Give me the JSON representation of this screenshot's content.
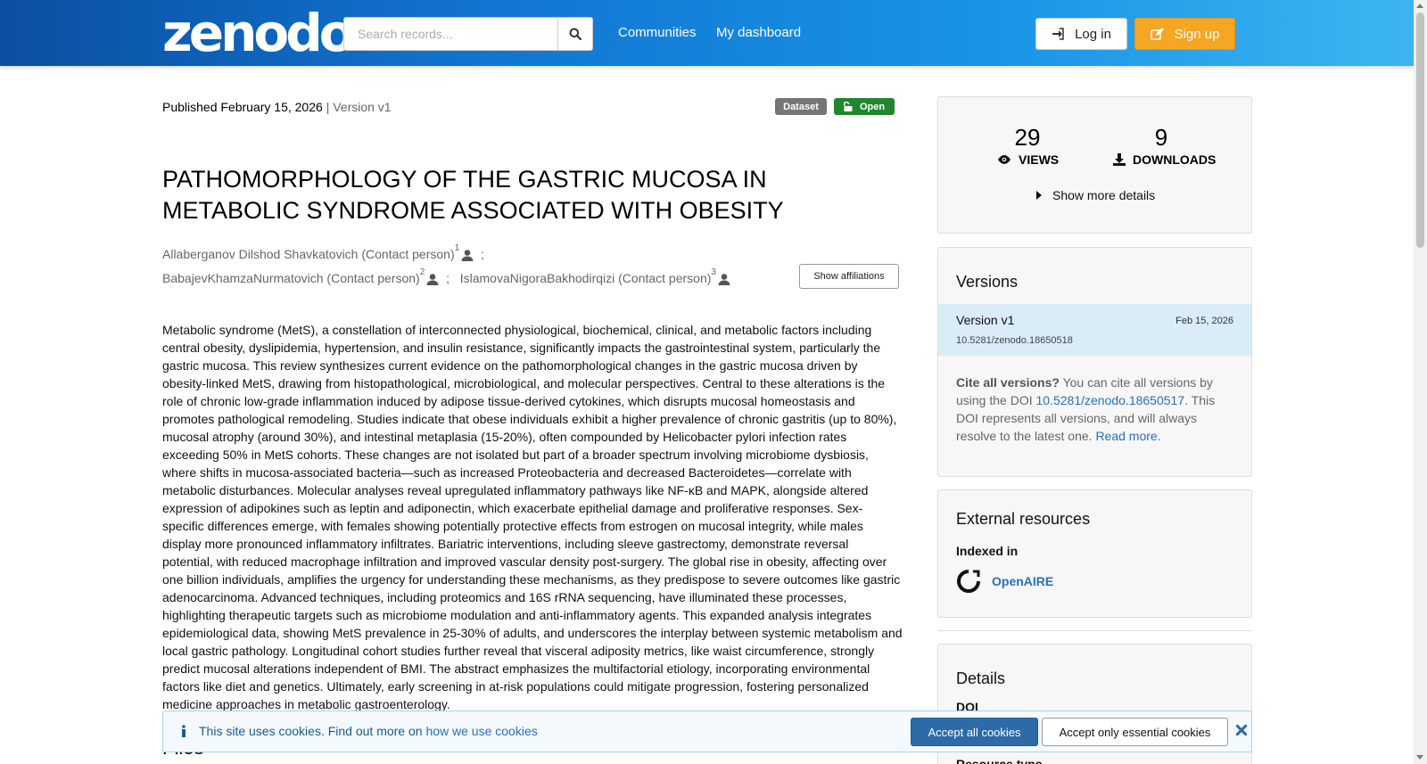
{
  "header": {
    "logo_text": "zenodo",
    "search_placeholder": "Search records...",
    "nav": [
      "Communities",
      "My dashboard"
    ],
    "login_label": "Log in",
    "signup_label": "Sign up"
  },
  "record": {
    "published_label": "Published February 15, 2026",
    "version_label": "| Version v1",
    "badge_type": "Dataset",
    "badge_access": "Open",
    "title": "PATHOMORPHOLOGY OF THE GASTRIC MUCOSA IN METABOLIC SYNDROME ASSOCIATED WITH OBESITY",
    "creators": [
      {
        "name": "Allaberganov Dilshod Shavkatovich (Contact person)",
        "sup": "1"
      },
      {
        "name": "BabajevKhamzaNurmatovich (Contact person)",
        "sup": "2"
      },
      {
        "name": "IslamovaNigoraBakhodirqizi (Contact person)",
        "sup": "3"
      }
    ],
    "show_affiliations_label": "Show affiliations",
    "abstract": "Metabolic syndrome (MetS), a constellation of interconnected physiological, biochemical, clinical, and metabolic factors including central obesity, dyslipidemia, hypertension, and insulin resistance, significantly impacts the gastrointestinal system, particularly the gastric mucosa. This review synthesizes current evidence on the pathomorphological changes in the gastric mucosa driven by obesity-linked MetS, drawing from histopathological, microbiological, and molecular perspectives. Central to these alterations is the role of chronic low-grade inflammation induced by adipose tissue-derived cytokines, which disrupts mucosal homeostasis and promotes pathological remodeling. Studies indicate that obese individuals exhibit a higher prevalence of chronic gastritis (up to 80%), mucosal atrophy (around 30%), and intestinal metaplasia (15-20%), often compounded by Helicobacter pylori infection rates exceeding 50% in MetS cohorts. These changes are not isolated but part of a broader spectrum involving microbiome dysbiosis, where shifts in mucosa-associated bacteria—such as increased Proteobacteria and decreased Bacteroidetes—correlate with metabolic disturbances. Molecular analyses reveal upregulated inflammatory pathways like NF-κB and MAPK, alongside altered expression of adipokines such as leptin and adiponectin, which exacerbate epithelial damage and proliferative responses. Sex-specific differences emerge, with females showing potentially protective effects from estrogen on mucosal integrity, while males display more pronounced inflammatory infiltrates. Bariatric interventions, including sleeve gastrectomy, demonstrate reversal potential, with reduced macrophage infiltration and improved vascular density post-surgery. The global rise in obesity, affecting over one billion individuals, amplifies the urgency for understanding these mechanisms, as they predispose to severe outcomes like gastric adenocarcinoma. Advanced techniques, including proteomics and 16S rRNA sequencing, have illuminated these processes, highlighting therapeutic targets such as microbiome modulation and anti-inflammatory agents. This expanded analysis integrates epidemiological data, showing MetS prevalence in 25-30% of adults, and underscores the interplay between systemic metabolism and local gastric pathology. Longitudinal cohort studies further reveal that visceral adiposity metrics, like waist circumference, strongly predict mucosal alterations independent of BMI. The abstract emphasizes the multifactorial etiology, incorporating environmental factors like diet and genetics. Ultimately, early screening in at-risk populations could mitigate progression, fostering personalized medicine approaches in metabolic gastroenterology.",
    "files_heading": "Files"
  },
  "stats": {
    "views": "29",
    "views_label": "VIEWS",
    "downloads": "9",
    "downloads_label": "DOWNLOADS",
    "more_details_label": "Show more details"
  },
  "versions": {
    "heading": "Versions",
    "current": {
      "name": "Version v1",
      "date": "Feb 15, 2026",
      "doi": "10.5281/zenodo.18650518"
    },
    "cite_bold": "Cite all versions?",
    "cite_text1": " You can cite all versions by using the DOI ",
    "cite_doi": "10.5281/zenodo.18650517",
    "cite_text2": ". This DOI represents all versions, and will always resolve to the latest one. ",
    "read_more": "Read more."
  },
  "external": {
    "heading": "External resources",
    "indexed_in": "Indexed in",
    "resource": "OpenAIRE"
  },
  "details": {
    "heading": "Details",
    "doi_label": "DOI",
    "resource_type_label": "Resource type"
  },
  "cookies": {
    "text": "This site uses cookies. Find out more on ",
    "link": "how we use cookies",
    "accept_all": "Accept all cookies",
    "accept_essential": "Accept only essential cookies"
  },
  "colors": {
    "header_start": "#0b4fa3",
    "header_end": "#3fb6f2",
    "signup": "#f5a623",
    "open_badge": "#21872f",
    "link": "#2a6ebb"
  }
}
